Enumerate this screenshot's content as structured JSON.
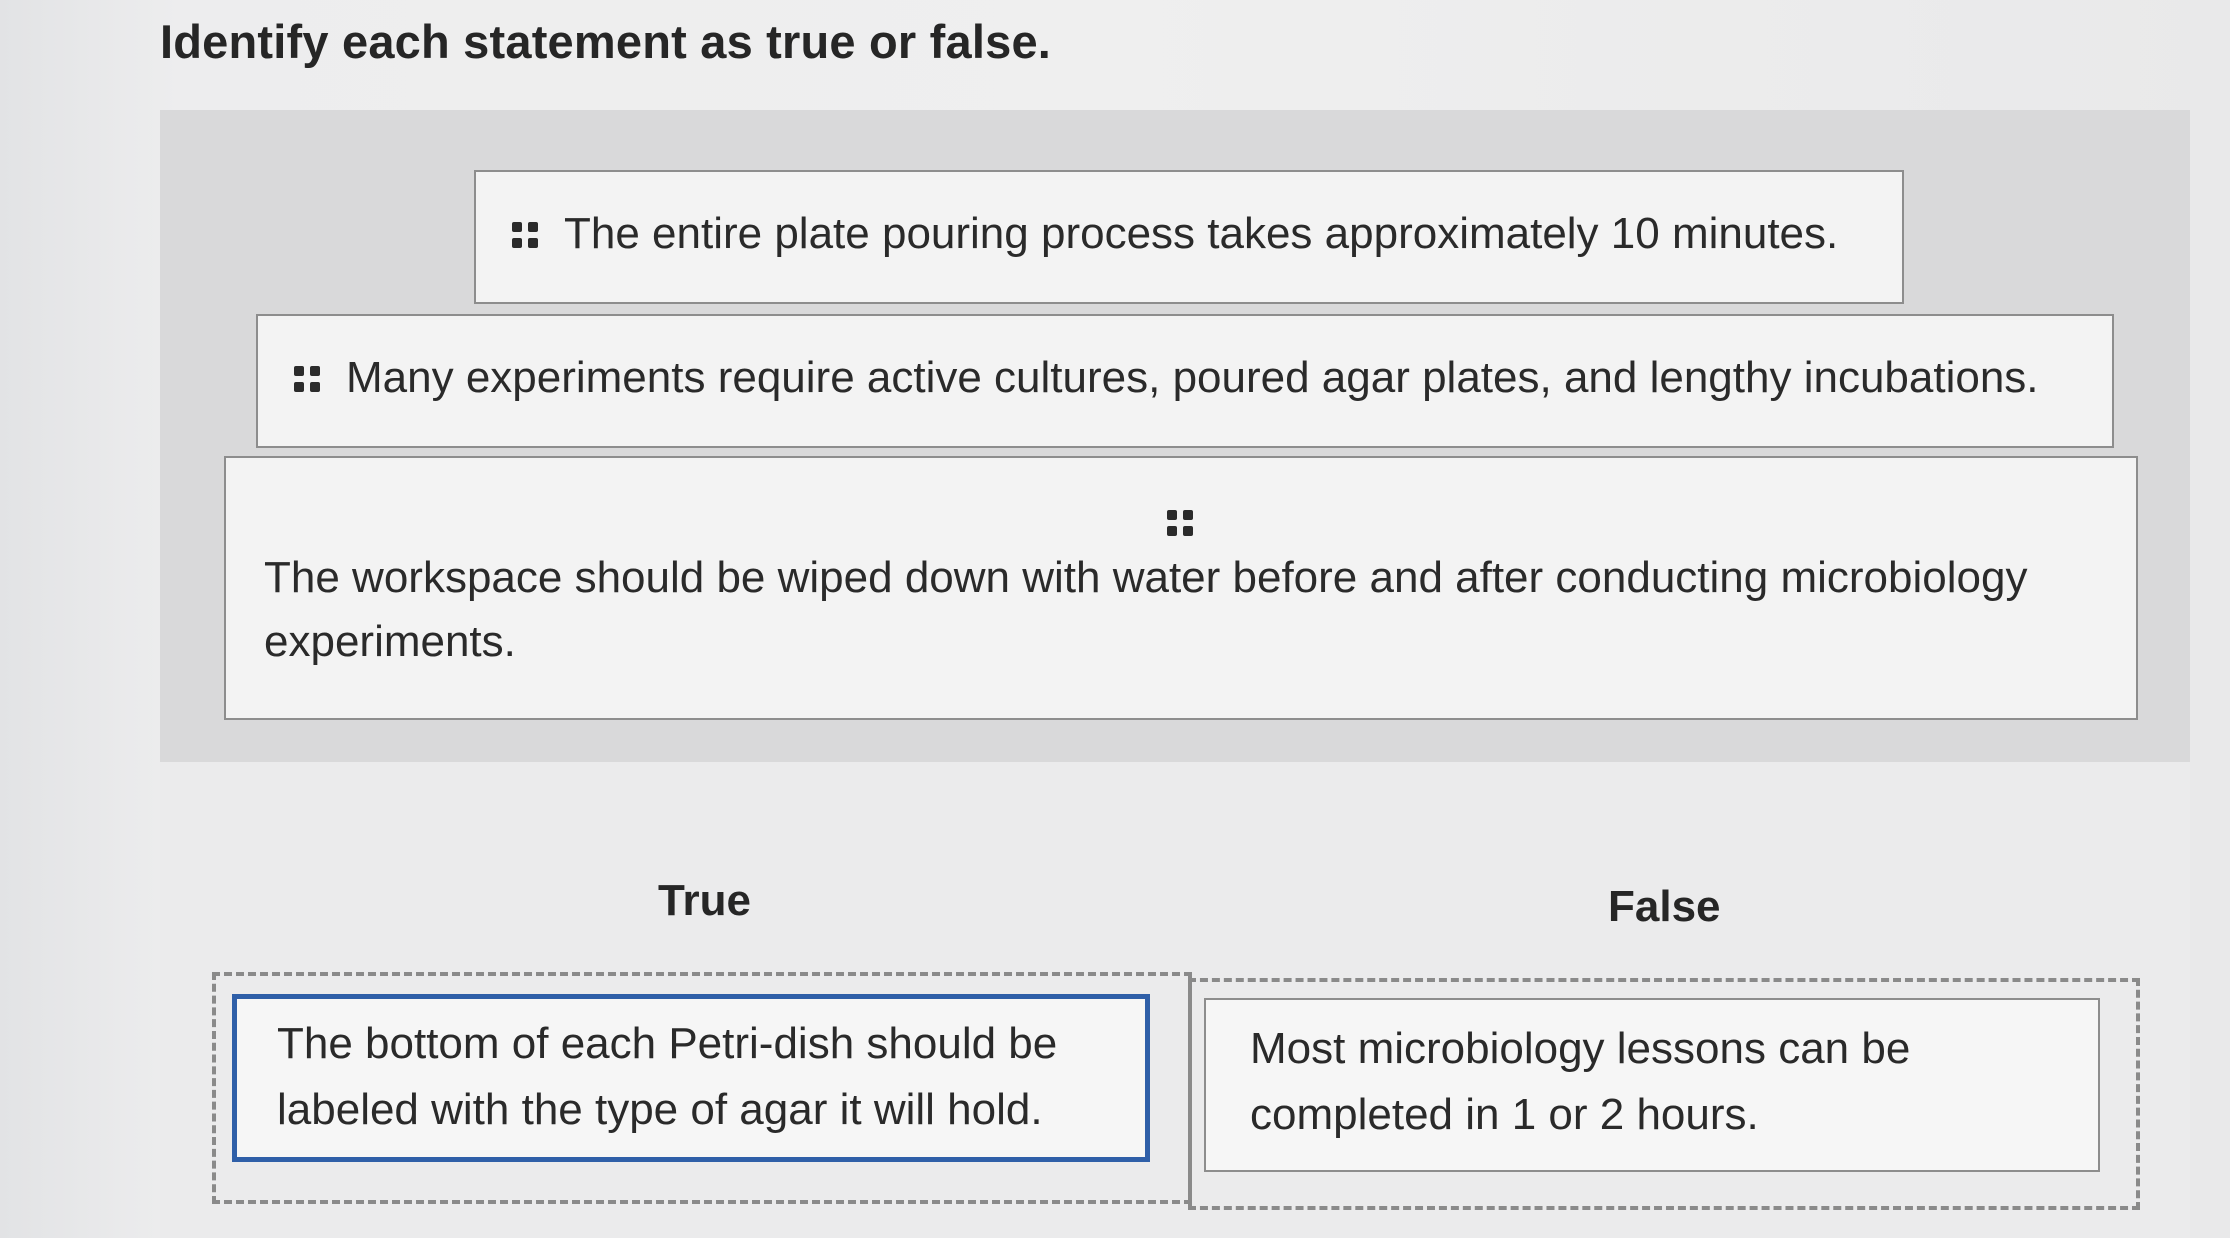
{
  "question": "Identify each statement as true or false.",
  "pool": {
    "items": [
      {
        "text": "The entire plate pouring process takes approximately 10 minutes."
      },
      {
        "text": "Many experiments require active cultures, poured agar plates, and lengthy incubations."
      },
      {
        "text": "The workspace should be wiped down with water before and after conducting microbiology experiments."
      }
    ]
  },
  "columns": {
    "true_label": "True",
    "false_label": "False"
  },
  "zones": {
    "true_items": [
      "The bottom of each Petri-dish should be labeled with the type of agar it will hold."
    ],
    "false_items": [
      "Most microbiology lessons can be completed in 1 or 2 hours."
    ]
  },
  "icons": {
    "drag_handle": "drag-handle-icon"
  },
  "colors": {
    "selected_border": "#2f5fa8"
  }
}
